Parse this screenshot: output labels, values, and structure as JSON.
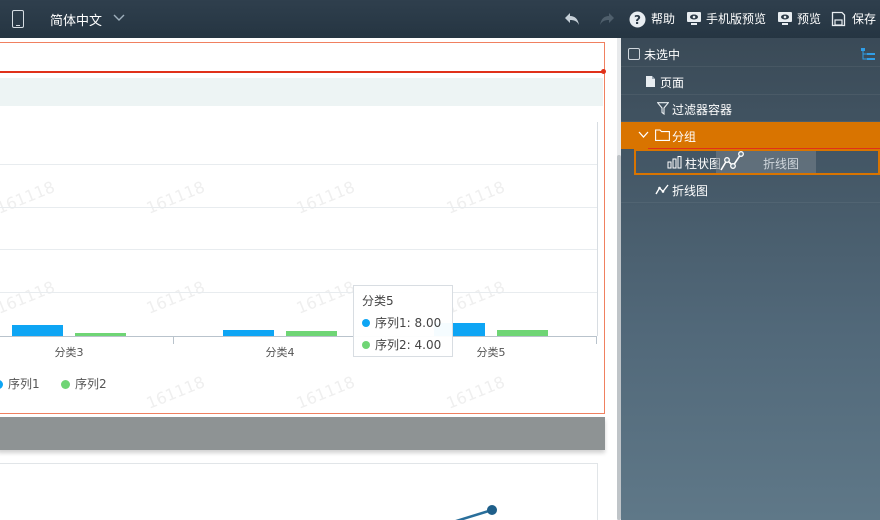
{
  "topbar": {
    "language": "简体中文",
    "help": "帮助",
    "mobile_preview": "手机版预览",
    "preview": "预览",
    "save": "保存"
  },
  "chart_data": {
    "type": "bar",
    "categories": [
      "分类3",
      "分类4",
      "分类5"
    ],
    "series": [
      {
        "name": "序列1",
        "color": "#0ea5f4"
      },
      {
        "name": "序列2",
        "color": "#6fd575"
      }
    ],
    "tooltip": {
      "title": "分类5",
      "rows": [
        {
          "series": "序列1",
          "value": "8.00"
        },
        {
          "series": "序列2",
          "value": "4.00"
        }
      ]
    },
    "values_note_series1_cat5": 8.0,
    "values_note_series2_cat5": 4.0,
    "watermark": "161118"
  },
  "tree": {
    "unselected": "未选中",
    "page": "页面",
    "filter_container": "过滤器容器",
    "group": "分组",
    "bar_chart": "柱状图",
    "line_chart": "折线图",
    "drag_ghost": "折线图"
  },
  "colors": {
    "accent_orange": "#d97400",
    "series1": "#0ea5f4",
    "series2": "#6fd575",
    "drop_indicator": "#e0311a"
  }
}
